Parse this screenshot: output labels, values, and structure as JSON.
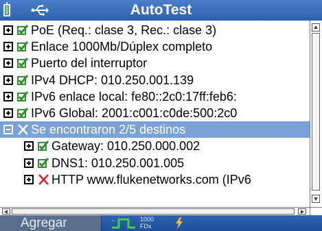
{
  "titlebar": {
    "title": "AutoTest",
    "battery_icon": "battery-icon",
    "usb_icon": "usb-icon"
  },
  "items": [
    {
      "expand": "plus",
      "status": "pass",
      "label": "PoE (Req.: clase 3, Rec.: clase 3)"
    },
    {
      "expand": "plus",
      "status": "pass",
      "label": "Enlace 1000Mb/Dúplex completo"
    },
    {
      "expand": "plus",
      "status": "pass",
      "label": "Puerto del interruptor"
    },
    {
      "expand": "plus",
      "status": "pass",
      "label": "IPv4 DHCP: 010.250.001.139"
    },
    {
      "expand": "plus",
      "status": "pass",
      "label": "IPv6 enlace local: fe80::2c0:17ff:feb6:"
    },
    {
      "expand": "plus",
      "status": "pass",
      "label": "IPv6 Global: 2001:c001:c0de:500:2c0"
    },
    {
      "expand": "minus",
      "status": "fail",
      "label": "Se encontraron 2/5 destinos",
      "selected": true
    },
    {
      "expand": "plus",
      "status": "pass",
      "label": "Gateway: 010.250.000.002",
      "child": true
    },
    {
      "expand": "plus",
      "status": "pass",
      "label": "DNS1: 010.250.001.005",
      "child": true
    },
    {
      "expand": "plus",
      "status": "fail",
      "label": "HTTP www.flukenetworks.com (IPv6",
      "child": true
    }
  ],
  "bottombar": {
    "add_button_label": "Agregar",
    "link_speed": "1000",
    "link_duplex": "FDx",
    "link_icon": "link-pulse-icon",
    "power_icon": "lightning-bolt-icon"
  },
  "colors": {
    "titlebar": "#2d5fae",
    "selection": "#7aa2d9",
    "pass_check": "#2f8f2f",
    "fail_x": "#e02020",
    "link_green": "#3fd43f",
    "bolt": "#f0c020"
  }
}
